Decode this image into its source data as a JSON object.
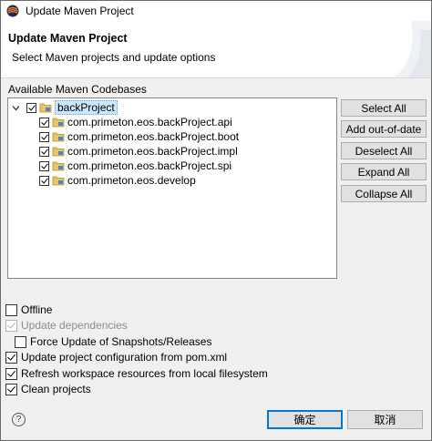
{
  "window": {
    "title": "Update Maven Project"
  },
  "header": {
    "title": "Update Maven Project",
    "subtitle": "Select Maven projects and update options"
  },
  "codebases": {
    "label": "Available Maven Codebases",
    "root": {
      "label": "backProject",
      "checked": true,
      "expanded": true
    },
    "children": [
      {
        "label": "com.primeton.eos.backProject.api",
        "checked": true
      },
      {
        "label": "com.primeton.eos.backProject.boot",
        "checked": true
      },
      {
        "label": "com.primeton.eos.backProject.impl",
        "checked": true
      },
      {
        "label": "com.primeton.eos.backProject.spi",
        "checked": true
      },
      {
        "label": "com.primeton.eos.develop",
        "checked": true
      }
    ]
  },
  "side_buttons": {
    "select_all": "Select All",
    "add_out_of_date": "Add out-of-date",
    "deselect_all": "Deselect All",
    "expand_all": "Expand All",
    "collapse_all": "Collapse All"
  },
  "options": {
    "offline": {
      "label": "Offline",
      "checked": false
    },
    "update_dependencies": {
      "label": "Update dependencies",
      "checked": true,
      "enabled": false
    },
    "force_update": {
      "label": "Force Update of Snapshots/Releases",
      "checked": false
    },
    "update_config": {
      "label": "Update project configuration from pom.xml",
      "checked": true
    },
    "refresh_workspace": {
      "label": "Refresh workspace resources from local filesystem",
      "checked": true
    },
    "clean_projects": {
      "label": "Clean projects",
      "checked": true
    }
  },
  "footer": {
    "help_icon": "?",
    "ok": "确定",
    "cancel": "取消"
  },
  "colors": {
    "selection": "#cce8ff",
    "default_button_border": "#0078d7",
    "folder": "#4a86c5"
  }
}
